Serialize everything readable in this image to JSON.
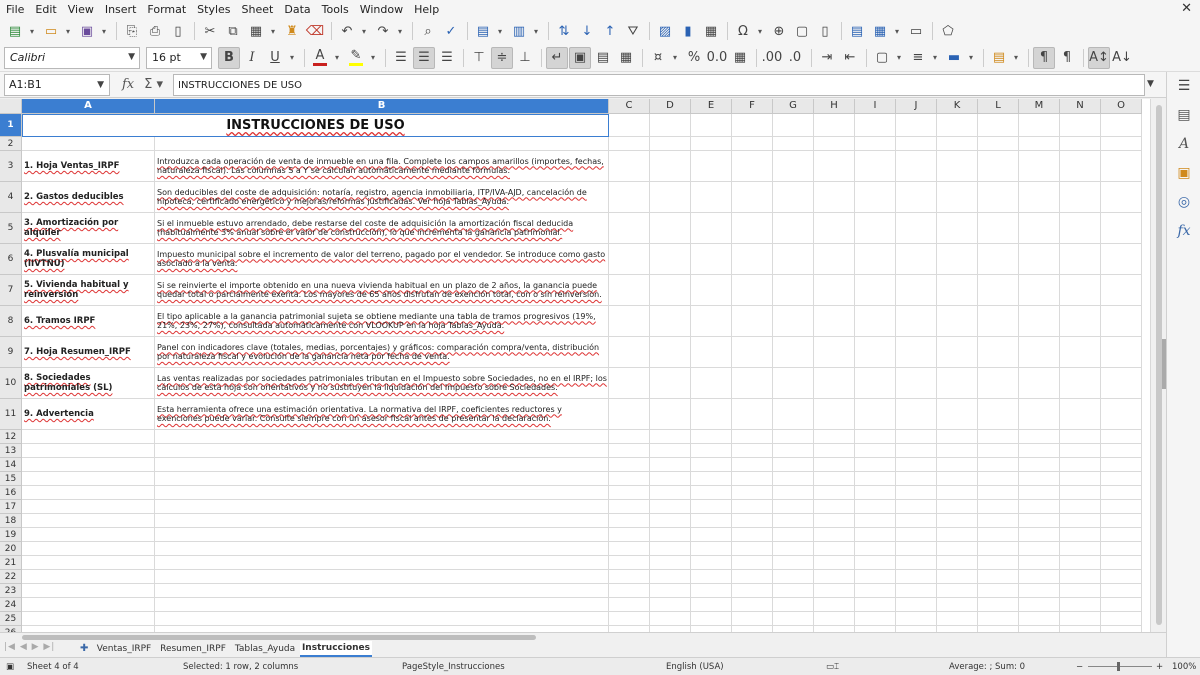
{
  "menu": [
    "File",
    "Edit",
    "View",
    "Insert",
    "Format",
    "Styles",
    "Sheet",
    "Data",
    "Tools",
    "Window",
    "Help"
  ],
  "font": {
    "name": "Calibri",
    "size": "16 pt"
  },
  "namebox": "A1:B1",
  "formula": "INSTRUCCIONES DE USO",
  "columns": [
    "A",
    "B",
    "C",
    "D",
    "E",
    "F",
    "G",
    "H",
    "I",
    "J",
    "K",
    "L",
    "M",
    "N",
    "O"
  ],
  "rows": [
    "1",
    "2",
    "3",
    "4",
    "5",
    "6",
    "7",
    "8",
    "9",
    "10",
    "11",
    "12",
    "13",
    "14",
    "15",
    "16",
    "17",
    "18",
    "19",
    "20",
    "21",
    "22",
    "23",
    "24",
    "25",
    "26"
  ],
  "title": "INSTRUCCIONES DE USO",
  "items": [
    {
      "label": "1. Hoja Ventas_IRPF",
      "desc": "Introduzca cada operación de venta de inmueble en una fila. Complete los campos amarillos (importes, fechas, naturaleza fiscal). Las columnas S a Y se calculan automáticamente mediante fórmulas."
    },
    {
      "label": "2. Gastos deducibles",
      "desc": "Son deducibles del coste de adquisición: notaría, registro, agencia inmobiliaria, ITP/IVA-AJD, cancelación de hipoteca, certificado energético y mejoras/reformas justificadas. Ver hoja Tablas_Ayuda."
    },
    {
      "label": "3. Amortización por alquiler",
      "desc": "Si el inmueble estuvo arrendado, debe restarse del coste de adquisición la amortización fiscal deducida (habitualmente 3% anual sobre el valor de construcción), lo que incrementa la ganancia patrimonial."
    },
    {
      "label": "4. Plusvalía municipal (IIVTNU)",
      "desc": "Impuesto municipal sobre el incremento de valor del terreno, pagado por el vendedor. Se introduce como gasto asociado a la venta."
    },
    {
      "label": "5. Vivienda habitual y reinversión",
      "desc": "Si se reinvierte el importe obtenido en una nueva vivienda habitual en un plazo de 2 años, la ganancia puede quedar total o parcialmente exenta. Los mayores de 65 años disfrutan de exención total, con o sin reinversión."
    },
    {
      "label": "6. Tramos IRPF",
      "desc": "El tipo aplicable a la ganancia patrimonial sujeta se obtiene mediante una tabla de tramos progresivos (19%, 21%, 23%, 27%), consultada automáticamente con VLOOKUP en la hoja Tablas_Ayuda."
    },
    {
      "label": "7. Hoja Resumen_IRPF",
      "desc": "Panel con indicadores clave (totales, medias, porcentajes) y gráficos: comparación compra/venta, distribución por naturaleza fiscal y evolución de la ganancia neta por fecha de venta."
    },
    {
      "label": "8. Sociedades patrimoniales (SL)",
      "desc": "Las ventas realizadas por sociedades patrimoniales tributan en el Impuesto sobre Sociedades, no en el IRPF; los cálculos de esta hoja son orientativos y no sustituyen la liquidación del Impuesto sobre Sociedades."
    },
    {
      "label": "9. Advertencia",
      "desc": "Esta herramienta ofrece una estimación orientativa. La normativa del IRPF, coeficientes reductores y exenciones puede variar. Consulte siempre con un asesor fiscal antes de presentar la declaración."
    }
  ],
  "tabs": [
    "Ventas_IRPF",
    "Resumen_IRPF",
    "Tablas_Ayuda",
    "Instrucciones"
  ],
  "active_tab": "Instrucciones",
  "status": {
    "sheet": "Sheet 4 of 4",
    "selection": "Selected: 1 row, 2 columns",
    "pagestyle": "PageStyle_Instrucciones",
    "language": "English (USA)",
    "sum": "Average: ; Sum: 0",
    "zoom": "100%"
  }
}
